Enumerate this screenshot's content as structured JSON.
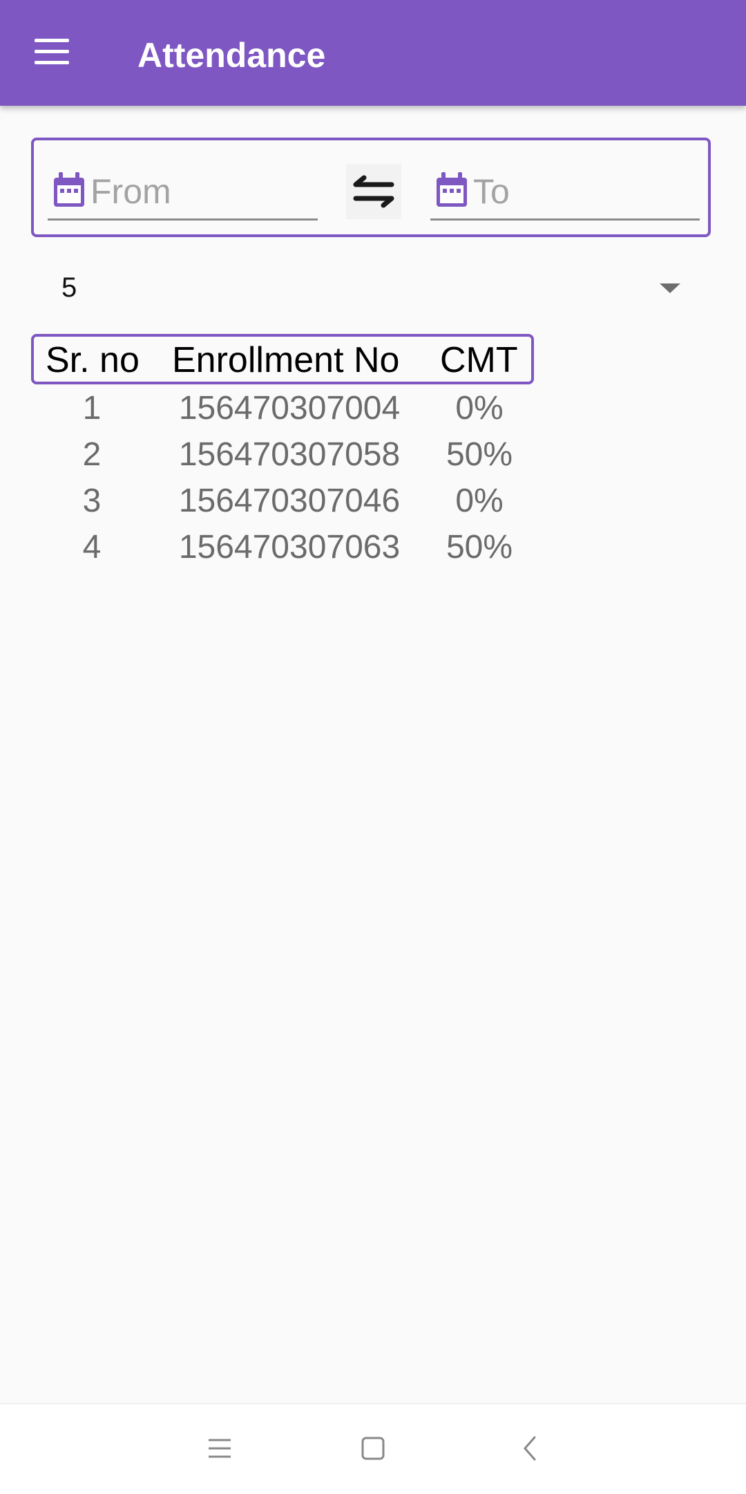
{
  "app_bar": {
    "title": "Attendance",
    "menu_icon": "menu-icon",
    "color": "#7e57c2"
  },
  "date_range": {
    "from_placeholder": "From",
    "to_placeholder": "To",
    "from_value": "",
    "to_value": "",
    "calendar_icon": "calendar-icon",
    "swap_icon": "swap-horizontal-icon"
  },
  "dropdown": {
    "selected": "5"
  },
  "table": {
    "headers": [
      "Sr. no",
      "Enrollment No",
      "CMT"
    ],
    "rows": [
      [
        "1",
        "156470307004",
        "0%"
      ],
      [
        "2",
        "156470307058",
        "50%"
      ],
      [
        "3",
        "156470307046",
        "0%"
      ],
      [
        "4",
        "156470307063",
        "50%"
      ]
    ]
  },
  "nav_bar": {
    "icons": [
      "recents-icon",
      "home-icon",
      "back-icon"
    ]
  }
}
